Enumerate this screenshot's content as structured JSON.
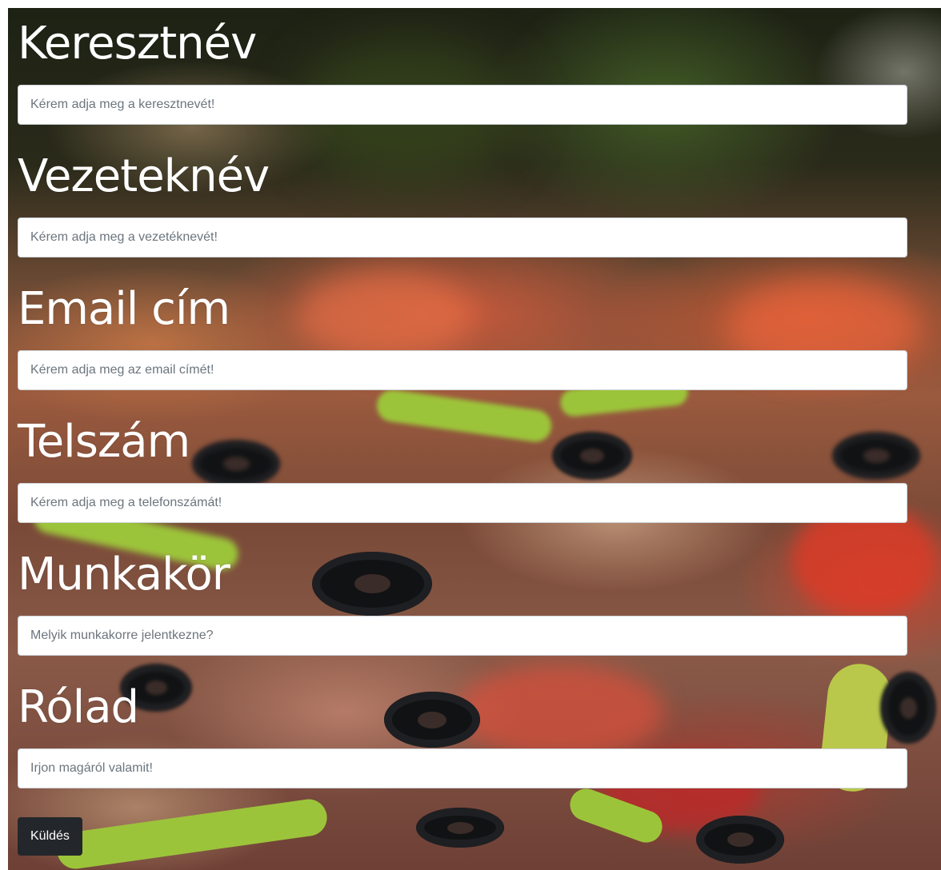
{
  "form": {
    "fields": [
      {
        "label": "Keresztnév",
        "placeholder": "Kérem adja meg a keresztnevét!"
      },
      {
        "label": "Vezeteknév",
        "placeholder": "Kérem adja meg a vezetéknevét!"
      },
      {
        "label": "Email cím",
        "placeholder": "Kérem adja meg az email címét!"
      },
      {
        "label": "Telszám",
        "placeholder": "Kérem adja meg a telefonszámát!"
      },
      {
        "label": "Munkakör",
        "placeholder": "Melyik munkakorre jelentkezne?"
      },
      {
        "label": "Rólad",
        "placeholder": "Irjon magáról valamit!"
      }
    ],
    "submit_label": "Küldés"
  },
  "background": {
    "image": "pizza-photo",
    "colors": {
      "olive": "#111214",
      "pepper": "#9cc43a",
      "tomato": "#d0452e"
    }
  }
}
